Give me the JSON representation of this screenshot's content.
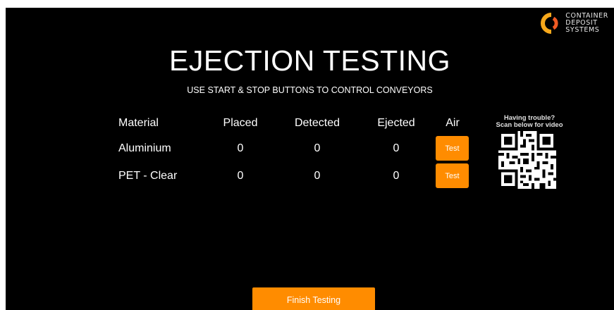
{
  "brand": {
    "logo_lines": [
      "CONTAINER",
      "DEPOSIT",
      "SYSTEMS"
    ],
    "accent_color": "#ff8c00"
  },
  "header": {
    "title": "EJECTION TESTING",
    "subtitle": "USE START & STOP BUTTONS TO CONTROL CONVEYORS"
  },
  "table": {
    "columns": [
      "Material",
      "Placed",
      "Detected",
      "Ejected",
      "Air"
    ],
    "rows": [
      {
        "material": "Aluminium",
        "placed": "0",
        "detected": "0",
        "ejected": "0",
        "air_button": "Test"
      },
      {
        "material": "PET - Clear",
        "placed": "0",
        "detected": "0",
        "ejected": "0",
        "air_button": "Test"
      }
    ]
  },
  "help": {
    "line1": "Having trouble?",
    "line2": "Scan below for video",
    "qr_icon": "qr-code-icon"
  },
  "footer": {
    "finish_label": "Finish Testing"
  }
}
